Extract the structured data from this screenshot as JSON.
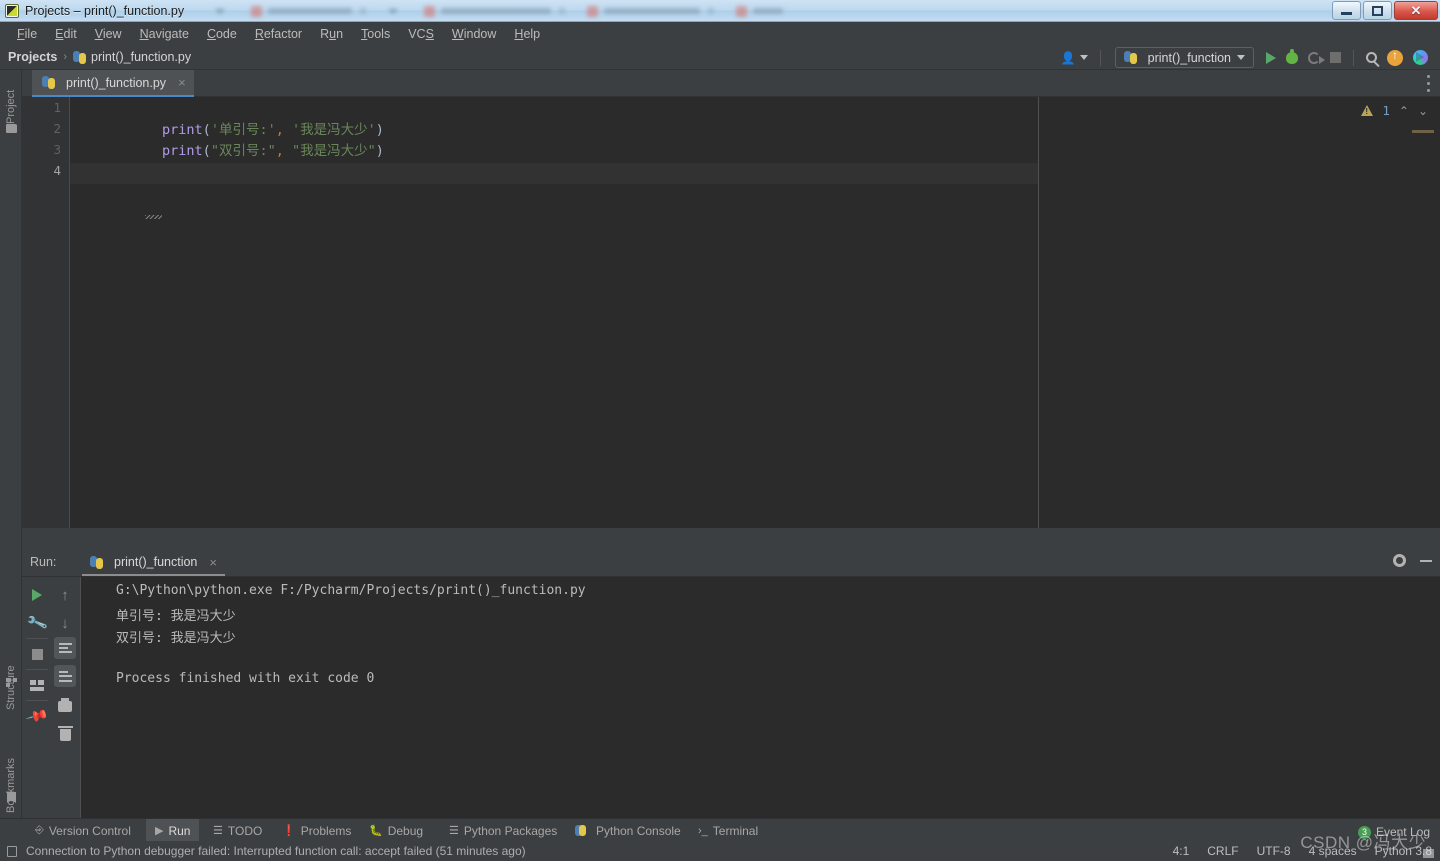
{
  "window": {
    "title": "Projects – print()_function.py",
    "icon": "pycharm-icon",
    "controls": {
      "minimize": "minimize",
      "maximize": "maximize",
      "close": "close"
    }
  },
  "menubar": {
    "items": [
      {
        "label": "File",
        "mnemonic": "F"
      },
      {
        "label": "Edit",
        "mnemonic": "E"
      },
      {
        "label": "View",
        "mnemonic": "V"
      },
      {
        "label": "Navigate",
        "mnemonic": "N"
      },
      {
        "label": "Code",
        "mnemonic": "C"
      },
      {
        "label": "Refactor",
        "mnemonic": "R"
      },
      {
        "label": "Run",
        "mnemonic": "u"
      },
      {
        "label": "Tools",
        "mnemonic": "T"
      },
      {
        "label": "VCS",
        "mnemonic": "S"
      },
      {
        "label": "Window",
        "mnemonic": "W"
      },
      {
        "label": "Help",
        "mnemonic": "H"
      }
    ]
  },
  "navbar": {
    "breadcrumb": {
      "project": "Projects",
      "separator": "›",
      "file": "print()_function.py"
    },
    "run_configuration": "print()_function",
    "actions": [
      "account-icon",
      "run-icon",
      "debug-icon",
      "coverage-icon",
      "stop-icon",
      "search-everywhere-icon",
      "update-icon",
      "ide-assistant-icon"
    ]
  },
  "left_stripes": [
    {
      "label": "Project",
      "icon": "folder-icon"
    },
    {
      "label": "Structure",
      "icon": "structure-icon"
    },
    {
      "label": "Bookmarks",
      "icon": "bookmark-icon"
    }
  ],
  "editor": {
    "tab": {
      "label": "print()_function.py",
      "close": "×"
    },
    "line_numbers": [
      "1",
      "2",
      "3",
      "4"
    ],
    "current_line": 4,
    "lines": [
      [
        {
          "t": "print",
          "c": "fn"
        },
        {
          "t": "(",
          "c": "paren"
        },
        {
          "t": "'单引号:'",
          "c": "str"
        },
        {
          "t": ",",
          "c": "comma"
        },
        {
          "t": " ",
          "c": "paren"
        },
        {
          "t": "'我是冯大少'",
          "c": "str"
        },
        {
          "t": ")",
          "c": "paren"
        }
      ],
      [
        {
          "t": "print",
          "c": "fn"
        },
        {
          "t": "(",
          "c": "paren"
        },
        {
          "t": "\"双引号:\"",
          "c": "str"
        },
        {
          "t": ",",
          "c": "comma"
        },
        {
          "t": " ",
          "c": "paren"
        },
        {
          "t": "\"我是冯大少\"",
          "c": "str"
        },
        {
          "t": ")",
          "c": "paren"
        }
      ],
      [],
      []
    ],
    "inspection": {
      "icon": "warning-icon",
      "count": "1",
      "prev": "⌃",
      "next": "⌄"
    },
    "more_options": "more-options-icon"
  },
  "run_window": {
    "label": "Run:",
    "tab": "print()_function",
    "tab_close": "×",
    "header_actions": [
      "settings-gear-icon",
      "hide-icon"
    ],
    "toolbar_left": [
      "rerun-icon",
      "wrench-icon",
      "stop-icon",
      "layout-icon",
      "pin-icon"
    ],
    "toolbar_right": [
      "up-arrow-icon",
      "down-arrow-icon",
      "soft-wrap-icon",
      "scroll-to-end-icon",
      "print-icon",
      "trash-icon"
    ],
    "console_lines": [
      "G:\\Python\\python.exe F:/Pycharm/Projects/print()_function.py",
      "单引号: 我是冯大少",
      "双引号: 我是冯大少",
      "",
      "Process finished with exit code 0"
    ]
  },
  "bottom_bar": {
    "items": [
      {
        "label": "Version Control",
        "icon": "branch-icon",
        "active": false
      },
      {
        "label": "Run",
        "icon": "play-icon",
        "active": true
      },
      {
        "label": "TODO",
        "icon": "list-icon",
        "active": false
      },
      {
        "label": "Problems",
        "icon": "error-icon",
        "active": false
      },
      {
        "label": "Debug",
        "icon": "bug-icon",
        "active": false
      },
      {
        "label": "Python Packages",
        "icon": "packages-icon",
        "active": false
      },
      {
        "label": "Python Console",
        "icon": "python-icon",
        "active": false
      },
      {
        "label": "Terminal",
        "icon": "terminal-icon",
        "active": false
      }
    ]
  },
  "status_bar": {
    "message": "Connection to Python debugger failed: Interrupted function call: accept failed (51 minutes ago)",
    "message_icon": "notification-icon",
    "caret_position": "4:1",
    "line_separator": "CRLF",
    "encoding": "UTF-8",
    "indent": "4 spaces",
    "interpreter": "Python 3.8",
    "event_log": {
      "label": "Event Log",
      "count": "3"
    }
  },
  "watermark": "CSDN @冯大少",
  "colors": {
    "ide_background": "#3c3f41",
    "editor_background": "#2b2b2b",
    "accent_blue": "#4a88c7",
    "run_green": "#59a869",
    "string_green": "#6a8759",
    "keyword_purple": "#b09ce8",
    "comma_orange": "#cc7832",
    "badge_green": "#499c54"
  }
}
